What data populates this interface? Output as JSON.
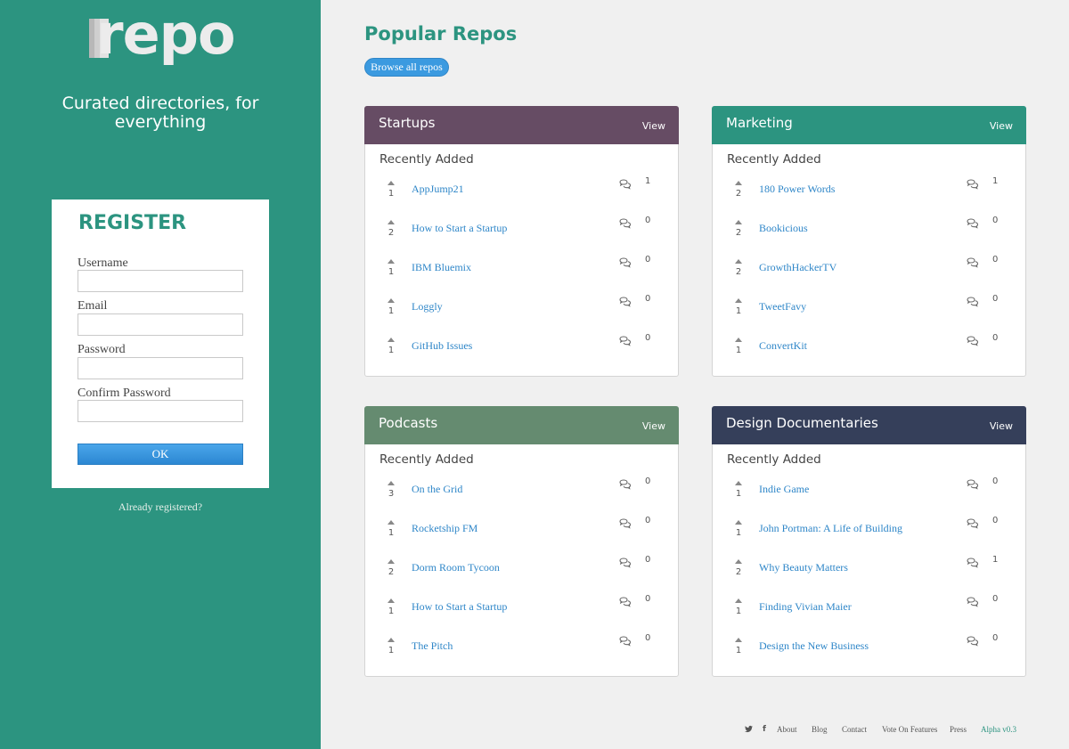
{
  "brand": {
    "logo_text": "repo",
    "tagline": "Curated directories, for everything"
  },
  "register": {
    "title": "REGISTER",
    "fields": [
      {
        "label": "Username",
        "value": ""
      },
      {
        "label": "Email",
        "value": ""
      },
      {
        "label": "Password",
        "value": ""
      },
      {
        "label": "Confirm Password",
        "value": ""
      }
    ],
    "ok_label": "OK",
    "already_text": "Already registered?"
  },
  "main": {
    "title": "Popular Repos",
    "browse_label": "Browse all repos"
  },
  "cards": [
    {
      "title": "Startups",
      "view_label": "View",
      "color": "#664c64",
      "recent_label": "Recently Added",
      "items": [
        {
          "name": "AppJump21",
          "votes": "1",
          "comments": "1"
        },
        {
          "name": "How to Start a Startup",
          "votes": "2",
          "comments": "0"
        },
        {
          "name": "IBM Bluemix",
          "votes": "1",
          "comments": "0"
        },
        {
          "name": "Loggly",
          "votes": "1",
          "comments": "0"
        },
        {
          "name": "GitHub Issues",
          "votes": "1",
          "comments": "0"
        }
      ]
    },
    {
      "title": "Marketing",
      "view_label": "View",
      "color": "#2c9480",
      "recent_label": "Recently Added",
      "items": [
        {
          "name": "180 Power Words",
          "votes": "2",
          "comments": "1"
        },
        {
          "name": "Bookicious",
          "votes": "2",
          "comments": "0"
        },
        {
          "name": "GrowthHackerTV",
          "votes": "2",
          "comments": "0"
        },
        {
          "name": "TweetFavy",
          "votes": "1",
          "comments": "0"
        },
        {
          "name": "ConvertKit",
          "votes": "1",
          "comments": "0"
        }
      ]
    },
    {
      "title": "Podcasts",
      "view_label": "View",
      "color": "#658b70",
      "recent_label": "Recently Added",
      "items": [
        {
          "name": "On the Grid",
          "votes": "3",
          "comments": "0"
        },
        {
          "name": "Rocketship FM",
          "votes": "1",
          "comments": "0"
        },
        {
          "name": "Dorm Room Tycoon",
          "votes": "2",
          "comments": "0"
        },
        {
          "name": "How to Start a Startup",
          "votes": "1",
          "comments": "0"
        },
        {
          "name": "The Pitch",
          "votes": "1",
          "comments": "0"
        }
      ]
    },
    {
      "title": "Design Documentaries",
      "view_label": "View",
      "color": "#353f5a",
      "recent_label": "Recently Added",
      "items": [
        {
          "name": "Indie Game",
          "votes": "1",
          "comments": "0"
        },
        {
          "name": "John Portman: A Life of Building",
          "votes": "1",
          "comments": "0"
        },
        {
          "name": "Why Beauty Matters",
          "votes": "2",
          "comments": "1"
        },
        {
          "name": "Finding Vivian Maier",
          "votes": "1",
          "comments": "0"
        },
        {
          "name": "Design the New Business",
          "votes": "1",
          "comments": "0"
        }
      ]
    }
  ],
  "footer": {
    "twitter_icon": "♥",
    "facebook_icon": "f",
    "links": [
      "About",
      "Blog",
      "Contact",
      "Vote On Features",
      "Press"
    ],
    "version": "Alpha v0.3"
  }
}
